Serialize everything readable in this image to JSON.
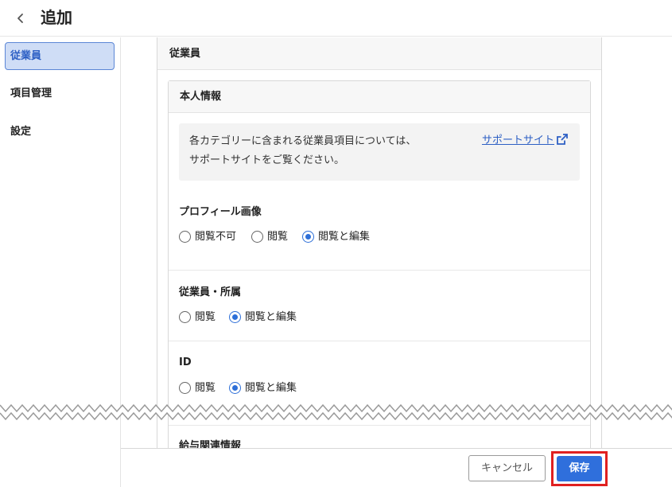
{
  "header": {
    "title": "追加"
  },
  "sidebar": {
    "items": [
      {
        "label": "従業員",
        "active": true
      },
      {
        "label": "項目管理",
        "active": false
      },
      {
        "label": "設定",
        "active": false
      }
    ]
  },
  "panel": {
    "title": "従業員",
    "section": {
      "title": "本人情報",
      "info": {
        "line1": "各カテゴリーに含まれる従業員項目については、",
        "line2": "サポートサイトをご覧ください。",
        "link": "サポートサイト"
      },
      "groups": [
        {
          "title": "プロフィール画像",
          "options": [
            "閲覧不可",
            "閲覧",
            "閲覧と編集"
          ],
          "selected": "閲覧と編集"
        },
        {
          "title": "従業員・所属",
          "options": [
            "閲覧",
            "閲覧と編集"
          ],
          "selected": "閲覧と編集"
        },
        {
          "title": "ID",
          "options": [
            "閲覧",
            "閲覧と編集"
          ],
          "selected": "閲覧と編集"
        }
      ],
      "next_partial_title": "給与関連情報"
    }
  },
  "footer": {
    "cancel_label": "キャンセル",
    "save_label": "保存"
  },
  "colors": {
    "accent": "#2f6fdc",
    "highlight": "#e02020",
    "active_nav_bg": "#cfddf6"
  }
}
